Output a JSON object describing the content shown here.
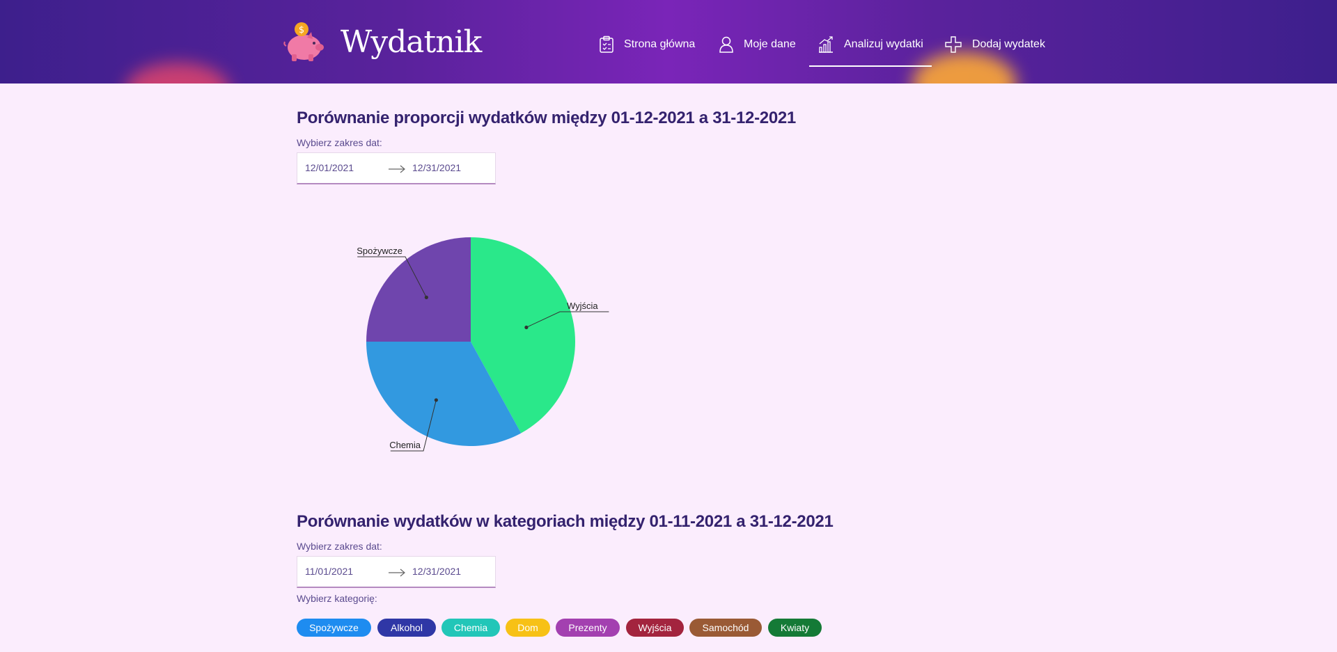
{
  "header": {
    "title": "Wydatnik",
    "nav": [
      {
        "label": "Strona główna",
        "icon": "clipboard-icon"
      },
      {
        "label": "Moje dane",
        "icon": "user-icon"
      },
      {
        "label": "Analizuj wydatki",
        "icon": "chart-icon",
        "active": true
      },
      {
        "label": "Dodaj wydatek",
        "icon": "plus-icon"
      }
    ]
  },
  "section1": {
    "title": "Porównanie proporcji wydatków między 01-12-2021 a 31-12-2021",
    "range_label": "Wybierz zakres dat:",
    "start_date": "12/01/2021",
    "end_date": "12/31/2021"
  },
  "chart_data": {
    "type": "pie",
    "slices": [
      {
        "label": "Wyjścia",
        "value": 42,
        "color": "#2ae88a"
      },
      {
        "label": "Chemia",
        "value": 33,
        "color": "#3299e0"
      },
      {
        "label": "Spożywcze",
        "value": 25,
        "color": "#6f45ad"
      }
    ]
  },
  "section2": {
    "title": "Porównanie wydatków w kategoriach między 01-11-2021 a 31-12-2021",
    "range_label": "Wybierz zakres dat:",
    "start_date": "11/01/2021",
    "end_date": "12/31/2021",
    "category_label": "Wybierz kategorię:",
    "categories": [
      {
        "label": "Spożywcze",
        "color": "#1e8cf0"
      },
      {
        "label": "Alkohol",
        "color": "#2f37a6"
      },
      {
        "label": "Chemia",
        "color": "#22c6b8"
      },
      {
        "label": "Dom",
        "color": "#f7c116"
      },
      {
        "label": "Prezenty",
        "color": "#a340b0"
      },
      {
        "label": "Wyjścia",
        "color": "#a3243e"
      },
      {
        "label": "Samochód",
        "color": "#9a5a35"
      },
      {
        "label": "Kwiaty",
        "color": "#147a36"
      }
    ]
  }
}
